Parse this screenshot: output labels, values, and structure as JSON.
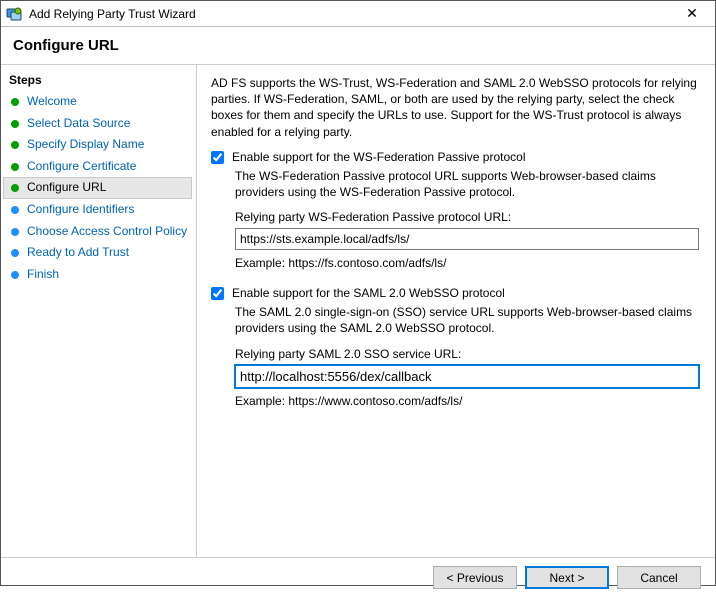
{
  "window": {
    "title": "Add Relying Party Trust Wizard",
    "close_glyph": "✕"
  },
  "header": {
    "title": "Configure URL"
  },
  "sidebar": {
    "heading": "Steps",
    "items": [
      {
        "label": "Welcome",
        "state": "completed"
      },
      {
        "label": "Select Data Source",
        "state": "completed"
      },
      {
        "label": "Specify Display Name",
        "state": "completed"
      },
      {
        "label": "Configure Certificate",
        "state": "completed"
      },
      {
        "label": "Configure URL",
        "state": "current"
      },
      {
        "label": "Configure Identifiers",
        "state": "upcoming"
      },
      {
        "label": "Choose Access Control Policy",
        "state": "upcoming"
      },
      {
        "label": "Ready to Add Trust",
        "state": "upcoming"
      },
      {
        "label": "Finish",
        "state": "upcoming"
      }
    ]
  },
  "content": {
    "intro": "AD FS supports the WS-Trust, WS-Federation and SAML 2.0 WebSSO protocols for relying parties.  If WS-Federation, SAML, or both are used by the relying party, select the check boxes for them and specify the URLs to use.  Support for the WS-Trust protocol is always enabled for a relying party.",
    "wsfed": {
      "checkbox_label": "Enable support for the WS-Federation Passive protocol",
      "checked": true,
      "desc": "The WS-Federation Passive protocol URL supports Web-browser-based claims providers using the WS-Federation Passive protocol.",
      "field_label": "Relying party WS-Federation Passive protocol URL:",
      "value": "https://sts.example.local/adfs/ls/",
      "example": "Example: https://fs.contoso.com/adfs/ls/"
    },
    "saml": {
      "checkbox_label": "Enable support for the SAML 2.0 WebSSO protocol",
      "checked": true,
      "desc": "The SAML 2.0 single-sign-on (SSO) service URL supports Web-browser-based claims providers using the SAML 2.0 WebSSO protocol.",
      "field_label": "Relying party SAML 2.0 SSO service URL:",
      "value": "http://localhost:5556/dex/callback",
      "example": "Example: https://www.contoso.com/adfs/ls/"
    }
  },
  "footer": {
    "previous": "< Previous",
    "next": "Next >",
    "cancel": "Cancel"
  }
}
